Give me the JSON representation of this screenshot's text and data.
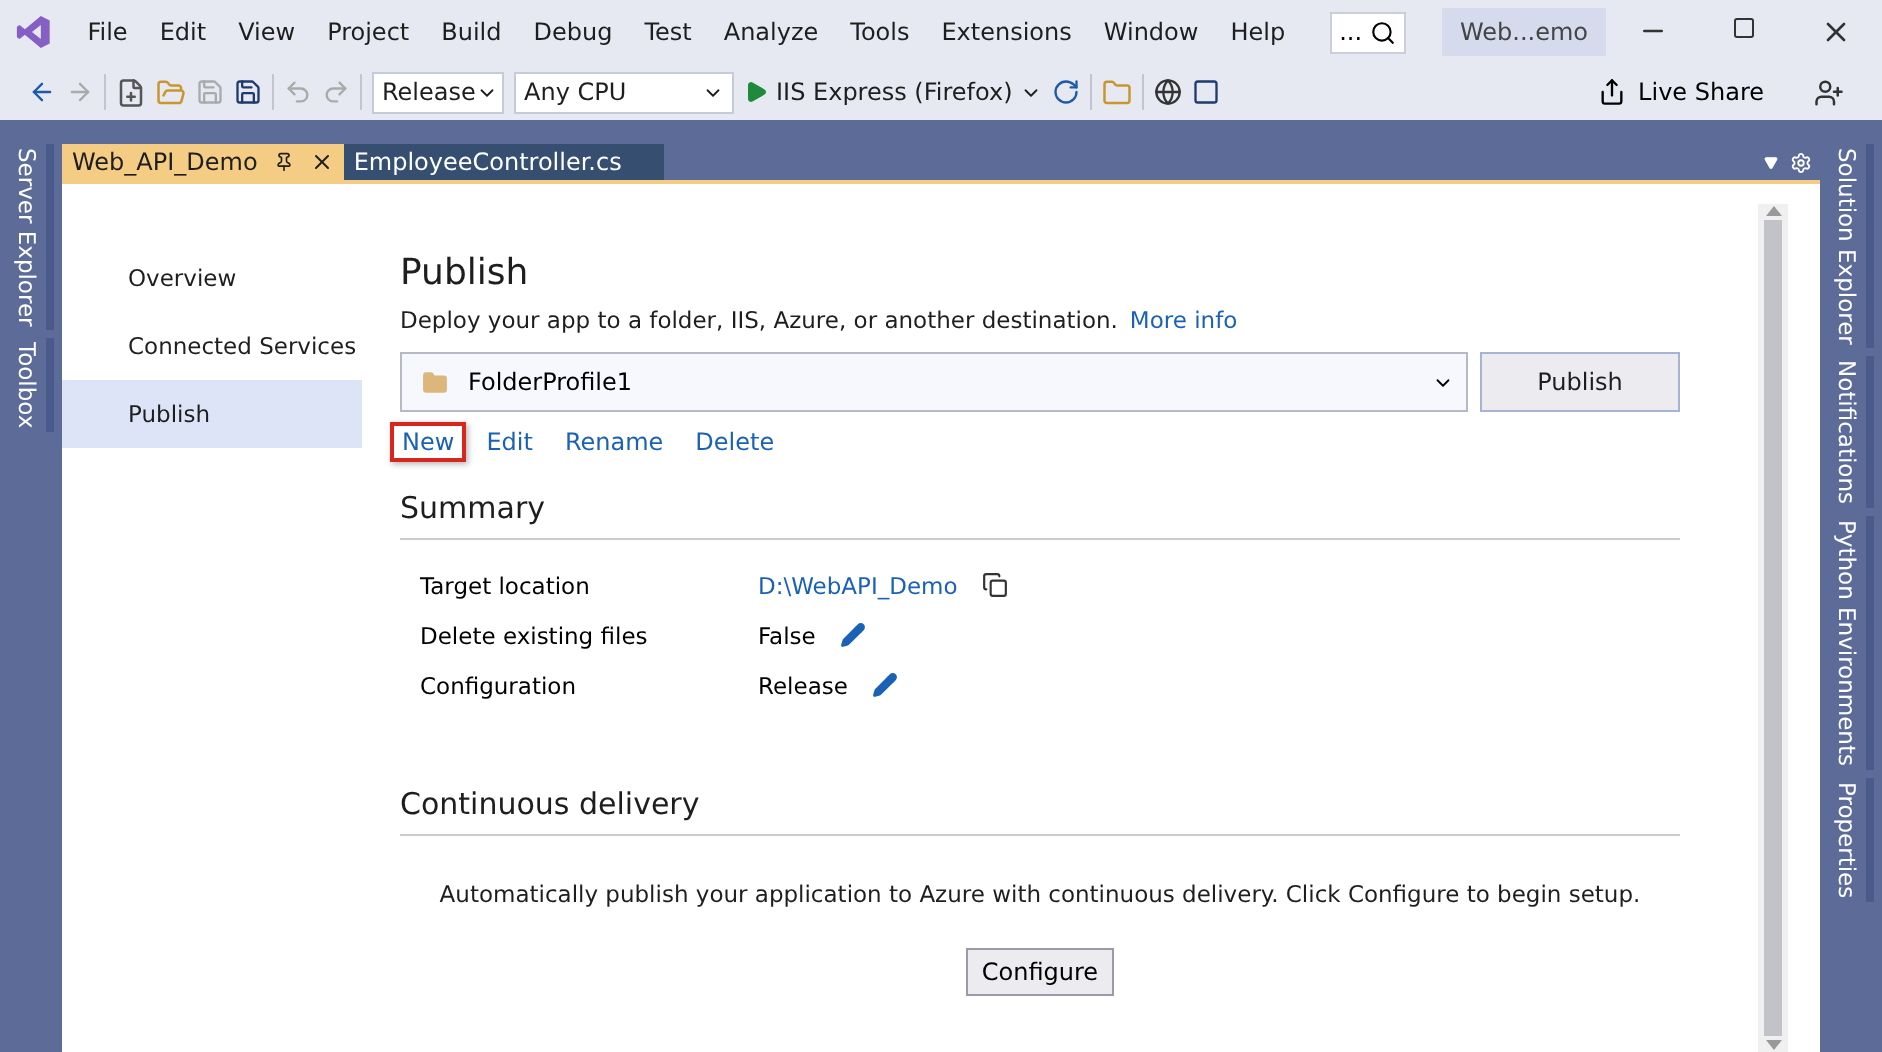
{
  "menu": [
    "File",
    "Edit",
    "View",
    "Project",
    "Build",
    "Debug",
    "Test",
    "Analyze",
    "Tools",
    "Extensions",
    "Window",
    "Help"
  ],
  "search": {
    "value": "..."
  },
  "window": {
    "title": "Web...emo"
  },
  "toolbar": {
    "configuration": "Release",
    "platform": "Any CPU",
    "run_target": "IIS Express (Firefox)",
    "live_share": "Live Share"
  },
  "left_tool_tabs": [
    "Server Explorer",
    "Toolbox"
  ],
  "right_tool_tabs": [
    "Solution Explorer",
    "Notifications",
    "Python Environments",
    "Properties"
  ],
  "tabs": [
    {
      "label": "Web_API_Demo",
      "selected": true
    },
    {
      "label": "EmployeeController.cs",
      "selected": false
    }
  ],
  "nav": [
    {
      "label": "Overview",
      "selected": false
    },
    {
      "label": "Connected Services",
      "selected": false
    },
    {
      "label": "Publish",
      "selected": true
    }
  ],
  "publish": {
    "title": "Publish",
    "description": "Deploy your app to a folder, IIS, Azure, or another destination.",
    "more_info": "More info",
    "profile": "FolderProfile1",
    "button": "Publish",
    "actions": [
      {
        "label": "New",
        "highlighted": true
      },
      {
        "label": "Edit",
        "highlighted": false
      },
      {
        "label": "Rename",
        "highlighted": false
      },
      {
        "label": "Delete",
        "highlighted": false
      }
    ]
  },
  "summary": {
    "title": "Summary",
    "rows": [
      {
        "label": "Target location",
        "value": "D:\\WebAPI_Demo",
        "kind": "link"
      },
      {
        "label": "Delete existing files",
        "value": "False",
        "kind": "editable"
      },
      {
        "label": "Configuration",
        "value": "Release",
        "kind": "editable"
      }
    ]
  },
  "continuous_delivery": {
    "title": "Continuous delivery",
    "text": "Automatically publish your application to Azure with continuous delivery. Click Configure to begin setup.",
    "button": "Configure"
  }
}
